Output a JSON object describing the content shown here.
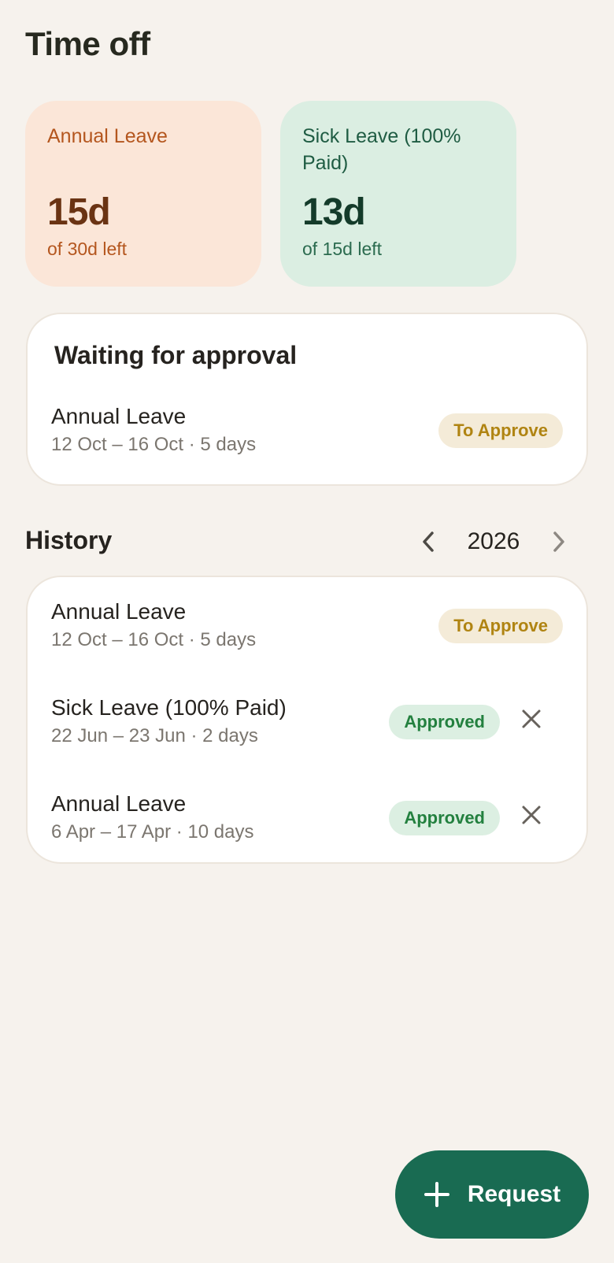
{
  "page": {
    "title": "Time off"
  },
  "balances": [
    {
      "label": "Annual Leave",
      "value": "15d",
      "subtitle": "of 30d left",
      "accent": "#b4561e",
      "bg": "#fbe6d8"
    },
    {
      "label": "Sick Leave (100% Paid)",
      "value": "13d",
      "subtitle": "of 15d left",
      "accent": "#1f5c43",
      "bg": "#dbeee2"
    }
  ],
  "pending": {
    "title": "Waiting for approval",
    "items": [
      {
        "type": "Annual Leave",
        "dates": "12 Oct – 16 Oct · 5 days",
        "status": "To Approve"
      }
    ]
  },
  "history": {
    "title": "History",
    "year": "2026",
    "prev_icon": "chevron-left-icon",
    "next_icon": "chevron-right-icon",
    "items": [
      {
        "type": "Annual Leave",
        "dates": "12 Oct – 16 Oct · 5 days",
        "status": "To Approve"
      },
      {
        "type": "Sick Leave (100% Paid)",
        "dates": "22 Jun – 23 Jun · 2 days",
        "status": "Approved",
        "cancel_icon": "close-icon"
      },
      {
        "type": "Annual Leave",
        "dates": "6 Apr – 17 Apr · 10 days",
        "status": "Approved",
        "cancel_icon": "close-icon"
      }
    ]
  },
  "fab": {
    "label": "Request",
    "icon": "plus-icon",
    "color": "#196b52"
  },
  "colors": {
    "background": "#f6f2ed",
    "pending_badge_bg": "#f4ebd8",
    "pending_badge_text": "#b08412",
    "approved_badge_bg": "#dcefe2",
    "approved_badge_text": "#23803f"
  }
}
